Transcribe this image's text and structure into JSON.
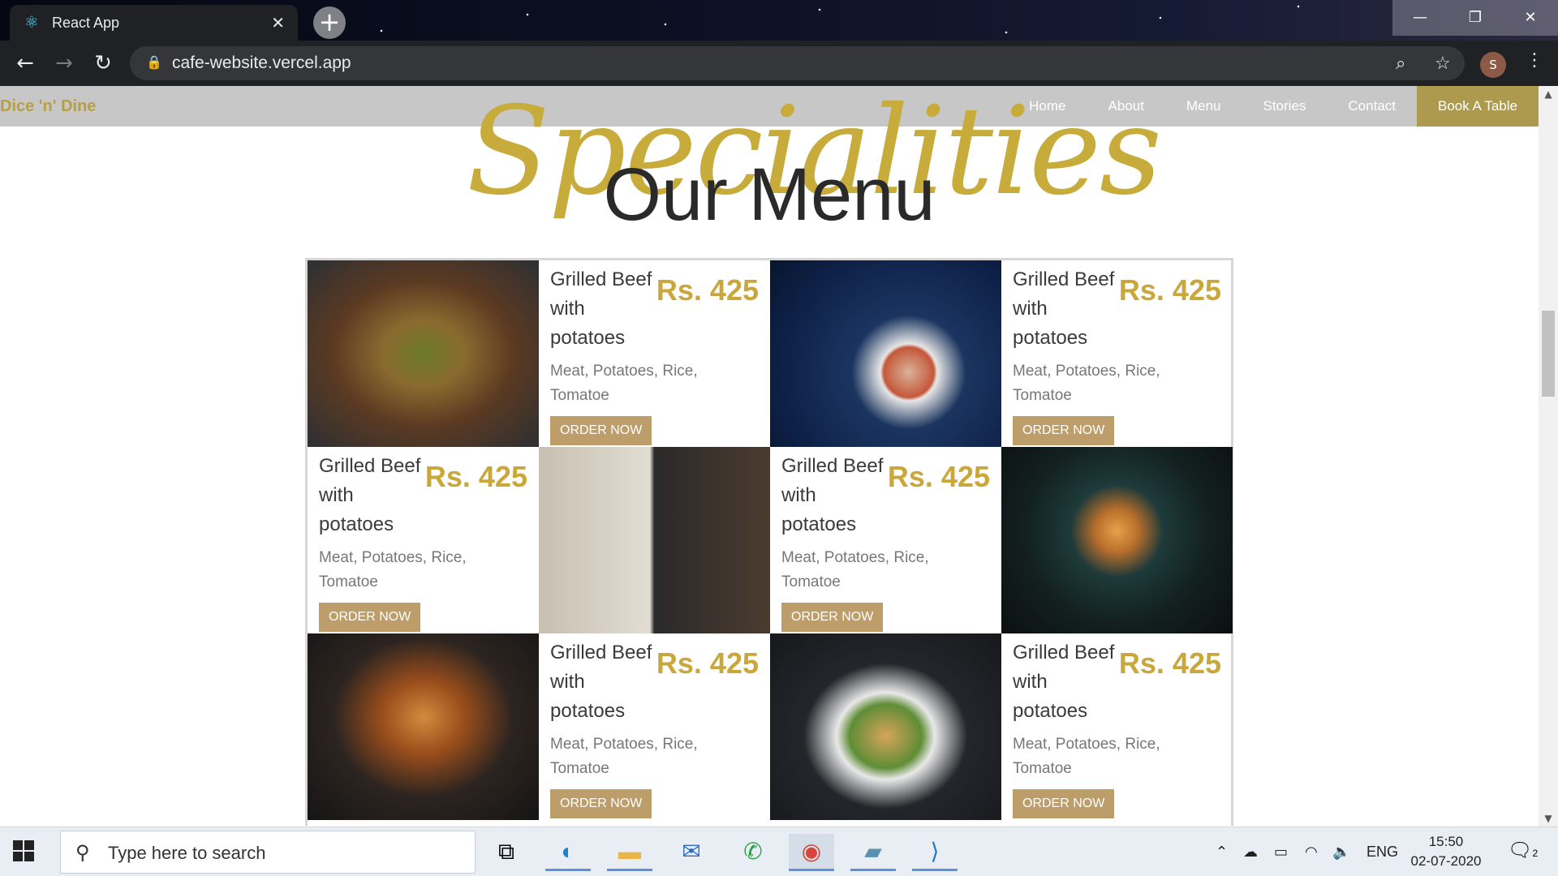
{
  "browser": {
    "tab_title": "React App",
    "tab_close": "✕",
    "new_tab": "+",
    "url": "cafe-website.vercel.app",
    "profile_initial": "S",
    "window": {
      "minimize": "—",
      "maximize": "❐",
      "close": "✕"
    }
  },
  "site": {
    "brand": "Dice 'n' Dine",
    "nav": [
      "Home",
      "About",
      "Menu",
      "Stories",
      "Contact"
    ],
    "cta": "Book A Table",
    "script_heading": "Specialities",
    "heading": "Our Menu"
  },
  "menu_items": [
    {
      "name": "Grilled Beef with potatoes",
      "price": "Rs. 425",
      "ingredients": "Meat, Potatoes, Rice, Tomatoe",
      "button": "ORDER NOW"
    },
    {
      "name": "Grilled Beef with potatoes",
      "price": "Rs. 425",
      "ingredients": "Meat, Potatoes, Rice, Tomatoe",
      "button": "ORDER NOW"
    },
    {
      "name": "Grilled Beef with potatoes",
      "price": "Rs. 425",
      "ingredients": "Meat, Potatoes, Rice, Tomatoe",
      "button": "ORDER NOW"
    },
    {
      "name": "Grilled Beef with potatoes",
      "price": "Rs. 425",
      "ingredients": "Meat, Potatoes, Rice, Tomatoe",
      "button": "ORDER NOW"
    },
    {
      "name": "Grilled Beef with potatoes",
      "price": "Rs. 425",
      "ingredients": "Meat, Potatoes, Rice, Tomatoe",
      "button": "ORDER NOW"
    },
    {
      "name": "Grilled Beef with potatoes",
      "price": "Rs. 425",
      "ingredients": "Meat, Potatoes, Rice, Tomatoe",
      "button": "ORDER NOW"
    }
  ],
  "taskbar": {
    "search_placeholder": "Type here to search",
    "language": "ENG",
    "time": "15:50",
    "date": "02-07-2020",
    "notification_count": "2"
  },
  "colors": {
    "accent_gold": "#c9a73a",
    "button_tan": "#bd9e6a",
    "nav_bg": "#c7c7c7",
    "book_btn": "#ad9a4e"
  }
}
